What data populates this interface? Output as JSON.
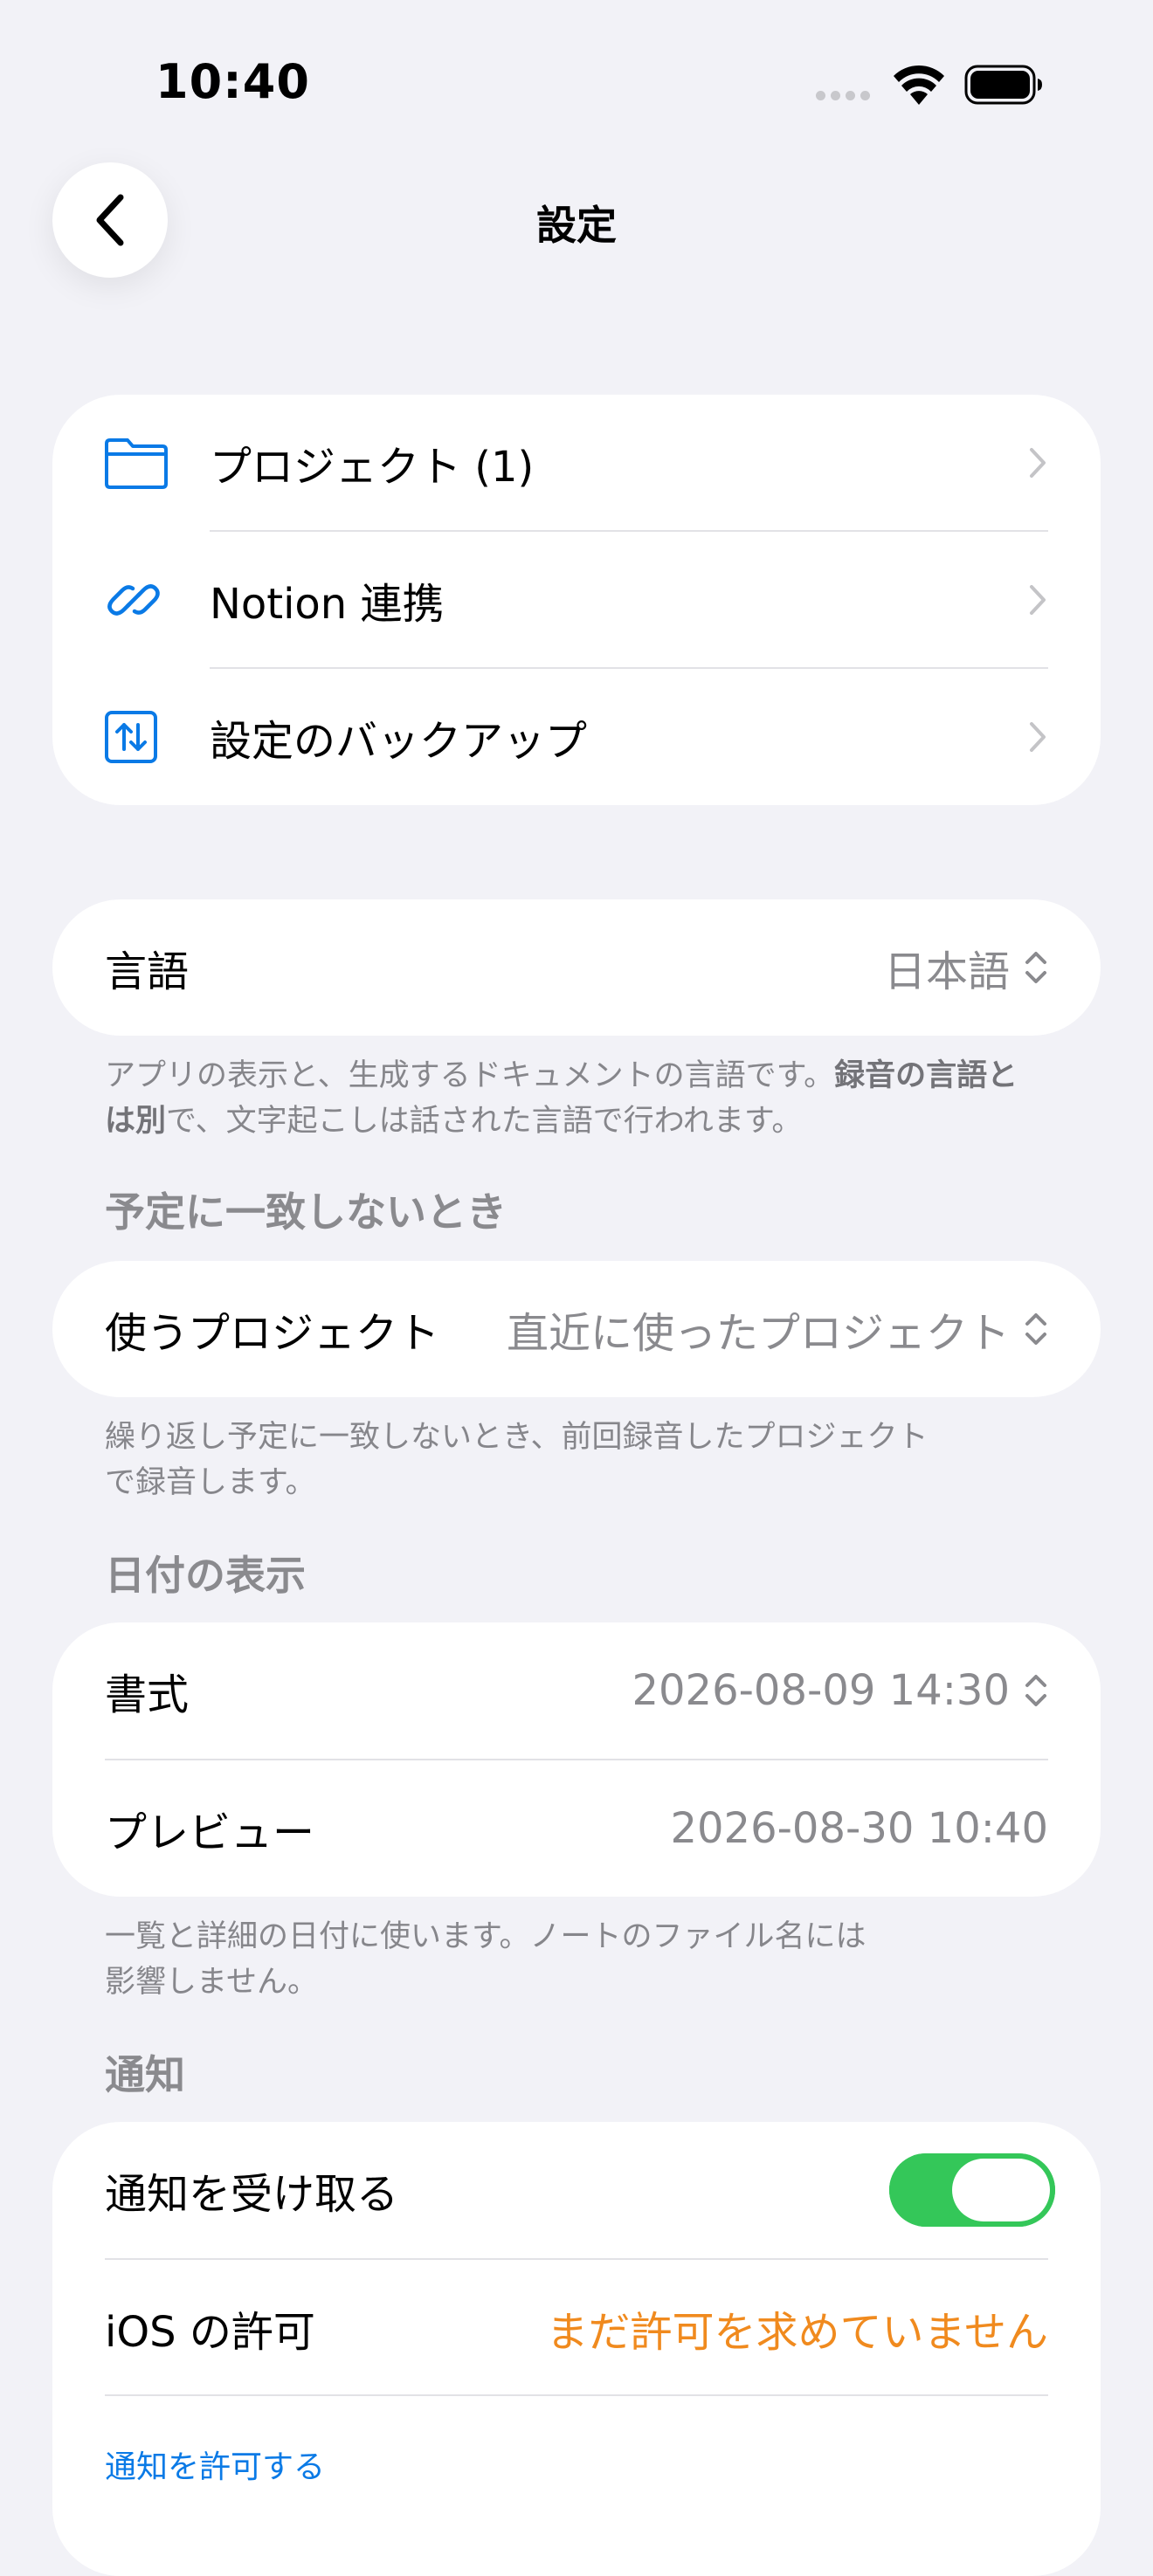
{
  "status_bar": {
    "time": "10:40"
  },
  "nav": {
    "title": "設定"
  },
  "group1": {
    "items": [
      {
        "label": "プロジェクト (1)"
      },
      {
        "label": "Notion 連携"
      },
      {
        "label": "設定のバックアップ"
      }
    ]
  },
  "language": {
    "label": "言語",
    "value": "日本語",
    "footnote_part1": "アプリの表示と、生成するドキュメントの言語です。",
    "footnote_bold": "録音の言語とは別",
    "footnote_part2": "で、文字起こしは話された言語で行われます。"
  },
  "unmatched": {
    "header": "予定に一致しないとき",
    "label": "使うプロジェクト",
    "value": "直近に使ったプロジェクト",
    "footnote_line1": "繰り返し予定に一致しないとき、前回録音したプロジェクト",
    "footnote_line2": "で録音します。"
  },
  "date_display": {
    "header": "日付の表示",
    "format_label": "書式",
    "format_value": "2026-08-09 14:30",
    "preview_label": "プレビュー",
    "preview_value": "2026-08-30 10:40",
    "footnote_line1": "一覧と詳細の日付に使います。ノートのファイル名には",
    "footnote_line2": "影響しません。"
  },
  "notifications": {
    "header": "通知",
    "receive_label": "通知を受け取る",
    "receive_on": true,
    "ios_label": "iOS の許可",
    "ios_value": "まだ許可を求めていません",
    "allow_link": "通知を許可する"
  },
  "colors": {
    "background": "#F2F2F7",
    "accent_blue": "#0A7AE6",
    "toggle_green": "#34C759",
    "warning_orange": "#F08A1E"
  }
}
